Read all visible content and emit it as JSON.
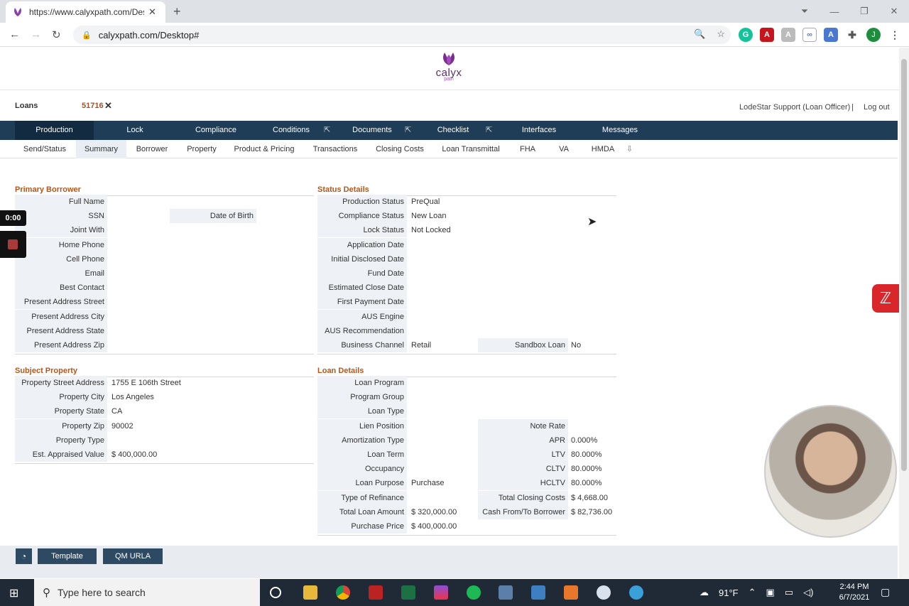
{
  "browser": {
    "tab_title": "https://www.calyxpath.com/Desk",
    "url": "calyxpath.com/Desktop#",
    "profile_initial": "J"
  },
  "app": {
    "logo_text": "calyx",
    "logo_sub": "path",
    "loans_label": "Loans",
    "loan_number": "51716",
    "user": "LodeStar Support (Loan Officer)",
    "separator": "|",
    "logout": "Log out"
  },
  "main_tabs": [
    "Production",
    "Lock",
    "Compliance",
    "Conditions",
    "Documents",
    "Checklist",
    "Interfaces",
    "Messages"
  ],
  "sub_tabs": [
    "Send/Status",
    "Summary",
    "Borrower",
    "Property",
    "Product & Pricing",
    "Transactions",
    "Closing Costs",
    "Loan Transmittal",
    "FHA",
    "VA",
    "HMDA"
  ],
  "primary_borrower": {
    "title": "Primary Borrower",
    "rows": [
      {
        "label": "Full Name",
        "value": ""
      },
      {
        "label": "SSN",
        "value": "",
        "label2": "Date of Birth",
        "value2": ""
      },
      {
        "label": "Joint With",
        "value": ""
      },
      {
        "label": "Home Phone",
        "value": ""
      },
      {
        "label": "Cell Phone",
        "value": ""
      },
      {
        "label": "Email",
        "value": ""
      },
      {
        "label": "Best Contact",
        "value": ""
      },
      {
        "label": "Present Address Street",
        "value": ""
      },
      {
        "label": "Present Address City",
        "value": ""
      },
      {
        "label": "Present Address State",
        "value": ""
      },
      {
        "label": "Present Address Zip",
        "value": ""
      }
    ]
  },
  "status_details": {
    "title": "Status Details",
    "rows": [
      {
        "label": "Production Status",
        "value": "PreQual"
      },
      {
        "label": "Compliance Status",
        "value": "New Loan"
      },
      {
        "label": "Lock Status",
        "value": "Not Locked"
      },
      {
        "label": "Application Date",
        "value": ""
      },
      {
        "label": "Initial Disclosed Date",
        "value": ""
      },
      {
        "label": "Fund Date",
        "value": ""
      },
      {
        "label": "Estimated Close Date",
        "value": ""
      },
      {
        "label": "First Payment Date",
        "value": ""
      },
      {
        "label": "AUS Engine",
        "value": ""
      },
      {
        "label": "AUS Recommendation",
        "value": ""
      },
      {
        "label": "Business Channel",
        "value": "Retail",
        "label2": "Sandbox Loan",
        "value2": "No"
      }
    ]
  },
  "subject_property": {
    "title": "Subject Property",
    "rows": [
      {
        "label": "Property Street Address",
        "value": "1755 E 106th Street"
      },
      {
        "label": "Property City",
        "value": "Los Angeles"
      },
      {
        "label": "Property State",
        "value": "CA"
      },
      {
        "label": "Property Zip",
        "value": "90002"
      },
      {
        "label": "Property Type",
        "value": ""
      },
      {
        "label": "Est. Appraised Value",
        "value": "$ 400,000.00"
      }
    ]
  },
  "loan_details": {
    "title": "Loan Details",
    "rows": [
      {
        "label": "Loan Program",
        "value": ""
      },
      {
        "label": "Program Group",
        "value": ""
      },
      {
        "label": "Loan Type",
        "value": ""
      },
      {
        "label": "Lien Position",
        "value": "",
        "label2": "Note Rate",
        "value2": ""
      },
      {
        "label": "Amortization Type",
        "value": "",
        "label2": "APR",
        "value2": "0.000%"
      },
      {
        "label": "Loan Term",
        "value": "",
        "label2": "LTV",
        "value2": "80.000%"
      },
      {
        "label": "Occupancy",
        "value": "",
        "label2": "CLTV",
        "value2": "80.000%"
      },
      {
        "label": "Loan Purpose",
        "value": "Purchase",
        "label2": "HCLTV",
        "value2": "80.000%"
      },
      {
        "label": "Type of Refinance",
        "value": "",
        "label2": "Total Closing Costs",
        "value2": "$ 4,668.00"
      },
      {
        "label": "Total Loan Amount",
        "value": "$ 320,000.00",
        "label2": "Cash From/To Borrower",
        "value2": "$ 82,736.00"
      },
      {
        "label": "Purchase Price",
        "value": "$ 400,000.00"
      }
    ]
  },
  "bottom_buttons": [
    "Template",
    "QM URLA"
  ],
  "recorder": {
    "time": "0:00"
  },
  "taskbar": {
    "search_placeholder": "Type here to search",
    "weather": "91°F",
    "time": "2:44 PM",
    "date": "6/7/2021"
  }
}
